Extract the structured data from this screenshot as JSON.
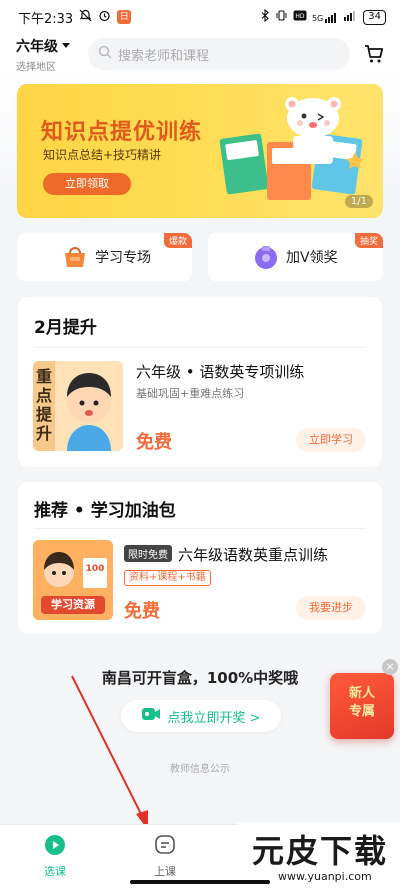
{
  "status_bar": {
    "time": "下午2:33",
    "app_badge": "日",
    "signal": "5G",
    "battery": "34"
  },
  "header": {
    "grade": "六年级",
    "region": "选择地区",
    "search_placeholder": "搜索老师和课程"
  },
  "banner": {
    "title": "知识点提优训练",
    "subtitle": "知识点总结+技巧精讲",
    "button": "立即领取",
    "pager": "1/1"
  },
  "quick_entries": [
    {
      "label": "学习专场",
      "tag": "爆款",
      "icon": "shopping-bag-icon"
    },
    {
      "label": "加V领奖",
      "tag": "抽奖",
      "icon": "gift-icon"
    }
  ],
  "february_card": {
    "title": "2月提升",
    "thumb_text": "重点提升",
    "course_title": "六年级 • 语数英专项训练",
    "course_sub": "基础巩固+重难点练习",
    "price": "免费",
    "button": "立即学习"
  },
  "recommend_card": {
    "title": "推荐 • 学习加油包",
    "thumb_banner": "学习资源",
    "thumb_number": "100",
    "limited_tag": "限时免费",
    "course_title": "六年级语数英重点训练",
    "resource_tag": "资料+课程+书籍",
    "price": "免费",
    "button": "我要进步"
  },
  "promo": {
    "text": "南昌可开盲盒，100%中奖哦",
    "button": "点我立即开奖 >"
  },
  "teacher_info": "教师信息公示",
  "float_badge": {
    "line1": "新人",
    "line2": "专属"
  },
  "tabs": [
    {
      "label": "选课",
      "icon": "play-circle-icon",
      "active": true
    },
    {
      "label": "上课",
      "icon": "chat-bubble-icon",
      "active": false
    }
  ],
  "watermark": {
    "title": "元皮下载",
    "url": "www.yuanpi.com"
  },
  "colors": {
    "accent": "#17c08a",
    "orange": "#f26b3a",
    "banner_yellow": "#ffd545"
  }
}
